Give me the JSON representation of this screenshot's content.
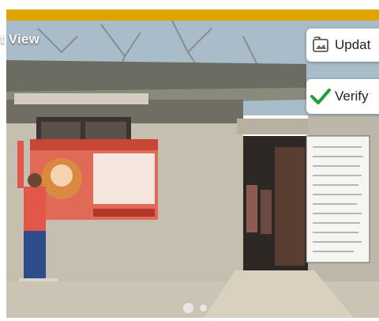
{
  "header": {
    "view_label": "t View"
  },
  "actions": {
    "update_label": "Updat",
    "verify_label": "Verify"
  },
  "photo": {
    "banner_caption": "",
    "carousel": {
      "total_slides": 2,
      "active_index": 0
    }
  },
  "colors": {
    "accent_bar": "#e0a400",
    "verify_check": "#1f9d3a"
  },
  "icons": {
    "update": "image-refresh-icon",
    "verify": "checkmark-icon"
  }
}
